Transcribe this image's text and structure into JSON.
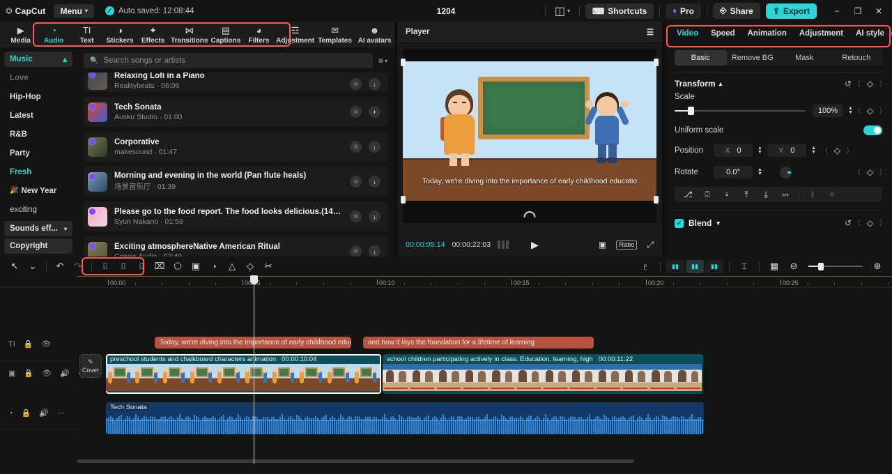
{
  "titlebar": {
    "app_name": "CapCut",
    "menu_label": "Menu",
    "autosave": "Auto saved: 12:08:44",
    "project_name": "1204",
    "shortcuts_label": "Shortcuts",
    "pro_label": "Pro",
    "share_label": "Share",
    "export_label": "Export",
    "minimize": "−",
    "maximize": "❐",
    "close": "✕"
  },
  "tool_tabs": [
    {
      "label": "Media",
      "icon": "media-icon",
      "glyph": "▶",
      "active": false
    },
    {
      "label": "Audio",
      "icon": "audio-icon",
      "glyph": "◔",
      "active": true
    },
    {
      "label": "Text",
      "icon": "text-icon",
      "glyph": "TI",
      "active": false
    },
    {
      "label": "Stickers",
      "icon": "stickers-icon",
      "glyph": "◑",
      "active": false
    },
    {
      "label": "Effects",
      "icon": "effects-icon",
      "glyph": "✦",
      "active": false
    },
    {
      "label": "Transitions",
      "icon": "transitions-icon",
      "glyph": "⋈",
      "active": false
    },
    {
      "label": "Captions",
      "icon": "captions-icon",
      "glyph": "▤",
      "active": false
    },
    {
      "label": "Filters",
      "icon": "filters-icon",
      "glyph": "◕",
      "active": false
    },
    {
      "label": "Adjustment",
      "icon": "adjustment-icon",
      "glyph": "☲",
      "active": false
    },
    {
      "label": "Templates",
      "icon": "templates-icon",
      "glyph": "✉",
      "active": false
    },
    {
      "label": "AI avatars",
      "icon": "ai-avatars-icon",
      "glyph": "☻",
      "active": false
    }
  ],
  "sidebar": {
    "header": "Music",
    "items": [
      {
        "label": "Love",
        "state": "dim"
      },
      {
        "label": "Hip-Hop",
        "state": "normal"
      },
      {
        "label": "Latest",
        "state": "normal"
      },
      {
        "label": "R&B",
        "state": "normal"
      },
      {
        "label": "Party",
        "state": "normal"
      },
      {
        "label": "Fresh",
        "state": "active"
      },
      {
        "label": "New Year",
        "state": "normal",
        "emoji": "🎉"
      },
      {
        "label": "exciting",
        "state": "plain"
      }
    ],
    "chips": [
      {
        "label": "Sounds eff...",
        "caret": true
      },
      {
        "label": "Copyright",
        "caret": false
      }
    ]
  },
  "search": {
    "placeholder": "Search songs or artists",
    "value": "",
    "sort_icon": "sort-icon"
  },
  "songs": [
    {
      "title": "Relaxing Lofi in a Piano",
      "artist": "Realitybeats",
      "duration": "06:06",
      "action": "download",
      "clipped": true,
      "color1": "#3a4a5a",
      "color2": "#6a5a4a"
    },
    {
      "title": "Tech Sonata",
      "artist": "Ausku Studio",
      "duration": "01:00",
      "action": "add",
      "clipped": false,
      "color1": "#e0452e",
      "color2": "#3b5fd4"
    },
    {
      "title": "Corporative",
      "artist": "makesound",
      "duration": "01:47",
      "action": "download",
      "clipped": false,
      "color1": "#6f7a4a",
      "color2": "#2e3a2a"
    },
    {
      "title": "Morning and evening in the world (Pan flute heals)",
      "artist": "场景音乐厅",
      "duration": "01:39",
      "action": "download",
      "clipped": false,
      "color1": "#7a9ab8",
      "color2": "#2a4a66"
    },
    {
      "title": "Please go to the food report. The food looks delicious.(1410584)",
      "artist": "Syun Nakano",
      "duration": "01:58",
      "action": "download",
      "clipped": false,
      "color1": "#f0a7c8",
      "color2": "#f7d6e6"
    },
    {
      "title": "Exciting atmosphereNative American Ritual",
      "artist": "Cowes Audio",
      "duration": "02:49",
      "action": "download",
      "clipped": false,
      "color1": "#8a7a5a",
      "color2": "#4a5a3a"
    }
  ],
  "player": {
    "title": "Player",
    "menu_icon": "hamburger-icon",
    "current_time": "00:00:05:14",
    "total_time": "00:00:22:03",
    "caption_text": "Today, we're diving into the importance of early childhood educatio",
    "play_icon": "play-icon",
    "ratio_label": "Ratio",
    "zoom_icon": "fit-icon",
    "fullscreen_icon": "fullscreen-icon"
  },
  "inspector": {
    "tabs": [
      {
        "label": "Video",
        "active": true
      },
      {
        "label": "Speed",
        "active": false
      },
      {
        "label": "Animation",
        "active": false
      },
      {
        "label": "Adjustment",
        "active": false
      },
      {
        "label": "AI style",
        "active": false
      }
    ],
    "more_icon": "chevron-right-icon",
    "segments": [
      {
        "label": "Basic",
        "active": true
      },
      {
        "label": "Remove BG",
        "active": false
      },
      {
        "label": "Mask",
        "active": false
      },
      {
        "label": "Retouch",
        "active": false
      }
    ],
    "transform": {
      "title": "Transform",
      "scale_label": "Scale",
      "scale_value": "100%",
      "scale_percent": 12,
      "uniform_label": "Uniform scale",
      "uniform_on": true,
      "position_label": "Position",
      "position_x_axis": "X",
      "position_x": "0",
      "position_y_axis": "Y",
      "position_y": "0",
      "rotate_label": "Rotate",
      "rotate_value": "0.0°"
    },
    "align_icons": [
      "⎇",
      "⍠",
      "⍣",
      "⤒",
      "⤓",
      "⤔",
      "‖",
      "≡"
    ],
    "blend": {
      "label": "Blend",
      "checked": true
    }
  },
  "timeline_toolbar": {
    "left_icons": [
      {
        "name": "select-tool-icon",
        "glyph": "↖",
        "dim": false
      },
      {
        "name": "tool-dropdown-icon",
        "glyph": "⌄",
        "dim": false
      },
      {
        "name": "undo-icon",
        "glyph": "↶",
        "dim": false
      },
      {
        "name": "redo-icon",
        "glyph": "↷",
        "dim": true
      },
      {
        "name": "split-icon",
        "glyph": "⌷",
        "dim": false
      },
      {
        "name": "trim-left-icon",
        "glyph": "⌷",
        "dim": false
      },
      {
        "name": "trim-right-icon",
        "glyph": "⌷",
        "dim": false
      },
      {
        "name": "delete-icon",
        "glyph": "⌧",
        "dim": false
      },
      {
        "name": "freeze-icon",
        "glyph": "⬠",
        "dim": false
      },
      {
        "name": "crop-frame-icon",
        "glyph": "▣",
        "dim": false
      },
      {
        "name": "reverse-icon",
        "glyph": "◔",
        "dim": false
      },
      {
        "name": "mirror-icon",
        "glyph": "△",
        "dim": false
      },
      {
        "name": "rotate-icon",
        "glyph": "◇",
        "dim": false
      },
      {
        "name": "crop-icon",
        "glyph": "✂",
        "dim": false
      }
    ],
    "right_icons": [
      {
        "name": "record-icon",
        "glyph": "♇"
      },
      {
        "name": "auto-cut-left-icon",
        "glyph": "▬"
      },
      {
        "name": "auto-cut-center-icon",
        "glyph": "▬"
      },
      {
        "name": "auto-cut-right-icon",
        "glyph": "▬"
      },
      {
        "name": "snap-icon",
        "glyph": "⌶"
      },
      {
        "name": "preview-icon",
        "glyph": "▦"
      },
      {
        "name": "zoom-out-icon",
        "glyph": "⊖"
      },
      {
        "name": "zoom-in-icon",
        "glyph": "⊕"
      }
    ]
  },
  "ruler": {
    "labels": [
      "00:00",
      "00:05",
      "00:10",
      "00:15",
      "00:20",
      "00:25"
    ]
  },
  "tracks": {
    "heads": [
      {
        "name": "text-track-head",
        "icons": [
          "TI",
          "🔒",
          "👁"
        ]
      },
      {
        "name": "video-track-head",
        "icons": [
          "▣",
          "🔒",
          "👁",
          "🔊",
          "⋯"
        ]
      },
      {
        "name": "audio-track-head",
        "icons": [
          "◔",
          "🔒",
          "🔊",
          "⋯"
        ]
      }
    ],
    "cover_label": "Cover",
    "caption_clips": [
      {
        "text": "Today, we're diving into the importance of early childhood educ"
      },
      {
        "text": "and how it lays the foundation for a lifetime of learning"
      }
    ],
    "video_clips": [
      {
        "name": "preschool students and chalkboard characters animation",
        "duration": "00:00:10:04",
        "selected": true
      },
      {
        "name": "school children participating actively in class. Education, learning, high",
        "duration": "00:00:11:22",
        "selected": false
      }
    ],
    "audio_clips": [
      {
        "name": "Tech Sonata"
      }
    ]
  },
  "colors": {
    "accent": "#2ad6d6",
    "highlight_box": "#ff5a52",
    "caption_clip": "#b7543f",
    "video_clip": "#0d5059",
    "audio_clip": "#123a66",
    "background": "#141414"
  }
}
